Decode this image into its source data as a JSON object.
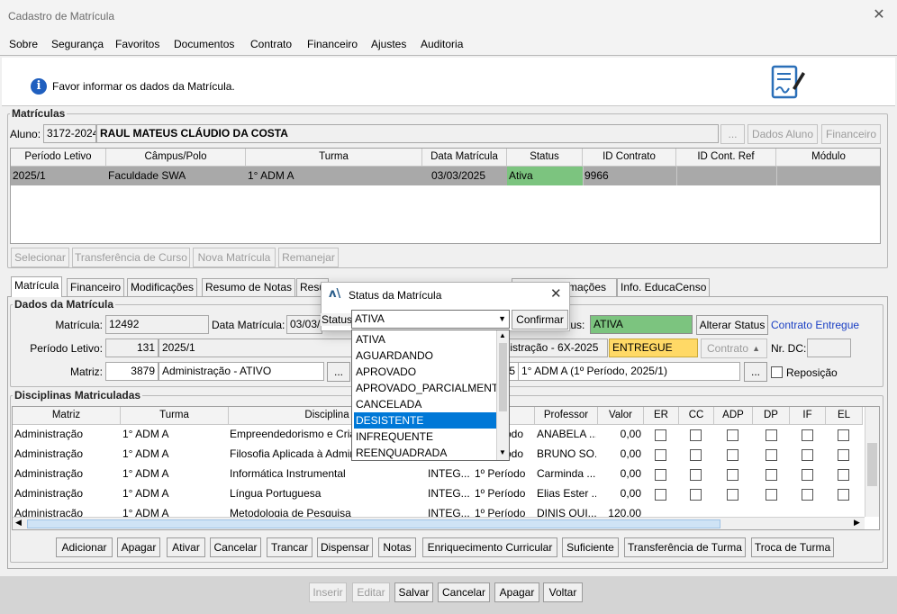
{
  "window": {
    "title": "Cadastro de Matrícula",
    "close_glyph": "✕"
  },
  "menu": [
    "Sobre",
    "Segurança",
    "Favoritos",
    "Documentos",
    "Contrato",
    "Financeiro",
    "Ajustes",
    "Auditoria"
  ],
  "header": {
    "message": "Favor informar os dados da Matrícula.",
    "info_glyph": "i"
  },
  "matriculas": {
    "legend": "Matrículas",
    "aluno_label": "Aluno:",
    "aluno_code": "3172-2024",
    "aluno_name": "RAUL MATEUS CLÁUDIO DA COSTA",
    "ellipsis": "...",
    "dados_aluno": "Dados Aluno",
    "financeiro": "Financeiro",
    "columns": [
      "Período Letivo",
      "Câmpus/Polo",
      "Turma",
      "Data Matrícula",
      "Status",
      "ID Contrato",
      "ID Cont. Ref",
      "Módulo"
    ],
    "row": [
      "2025/1",
      "Faculdade SWA",
      "1° ADM A",
      "03/03/2025",
      "Ativa",
      "9966",
      "",
      ""
    ],
    "buttons": [
      "Selecionar",
      "Transferência de Curso",
      "Nova Matrícula",
      "Remanejar"
    ]
  },
  "tabs": [
    "Matrícula",
    "Financeiro",
    "Modificações",
    "Resumo de Notas",
    "Resu",
    "rmações",
    "Info. EducaCenso"
  ],
  "dados": {
    "legend": "Dados da Matrícula",
    "matricula_label": "Matrícula:",
    "matricula_value": "12492",
    "data_label": "Data Matrícula:",
    "data_value": "03/03/",
    "status_label": "tus:",
    "status_value": "ATIVA",
    "alterar_status": "Alterar Status",
    "contrato_entregue": "Contrato Entregue",
    "periodo_label": "Período Letivo:",
    "periodo_id": "131",
    "periodo_value": "2025/1",
    "curso_value": "inistração - 6X-2025",
    "entregue": "ENTREGUE",
    "contrato_btn": "Contrato",
    "nr_dc_label": "Nr. DC:",
    "nr_dc_value": "",
    "matriz_label": "Matriz:",
    "matriz_id": "3879",
    "matriz_value": "Administração - ATIVO",
    "turma_id": "5",
    "turma_value": "1° ADM A (1º Período, 2025/1)",
    "reposicao": "Reposição"
  },
  "disciplinas": {
    "legend": "Disciplinas Matriculadas",
    "columns": [
      "Matriz",
      "Turma",
      "Disciplina",
      "",
      "",
      "Professor",
      "Valor",
      "ER",
      "CC",
      "ADP",
      "DP",
      "IF",
      "EL"
    ],
    "rows": [
      [
        "Administração",
        "1° ADM A",
        "Empreendedorismo e Cria",
        "",
        "odo",
        "ANABELA ...",
        "0,00"
      ],
      [
        "Administração",
        "1° ADM A",
        "Filosofia Aplicada à Admin",
        "",
        "odo",
        "BRUNO SO...",
        "0,00"
      ],
      [
        "Administração",
        "1° ADM A",
        "Informática Instrumental",
        "INTEG...",
        "1º Período",
        "Carminda ...",
        "0,00"
      ],
      [
        "Administração",
        "1° ADM A",
        "Língua Portuguesa",
        "INTEG...",
        "1º Período",
        "Elias Ester ...",
        "0,00"
      ],
      [
        "Administração",
        "1° ADM A",
        "Metodologia de Pesquisa",
        "INTEG...",
        "1º Período",
        "DINIS QUI...",
        "120,00"
      ]
    ],
    "buttons": [
      "Adicionar",
      "Apagar",
      "Ativar",
      "Cancelar",
      "Trancar",
      "Dispensar",
      "Notas",
      "Enriquecimento Curricular",
      "Suficiente",
      "Transferência de Turma",
      "Troca de Turma"
    ]
  },
  "dialog": {
    "title": "Status da Matrícula",
    "status_label": "Status:",
    "status_value": "ATIVA",
    "confirmar": "Confirmar",
    "options": [
      "ATIVA",
      "AGUARDANDO",
      "APROVADO",
      "APROVADO_PARCIALMENTE",
      "CANCELADA",
      "DESISTENTE",
      "INFREQUENTE",
      "REENQUADRADA"
    ],
    "selected": "DESISTENTE"
  },
  "footer": {
    "buttons": [
      "Inserir",
      "Editar",
      "Salvar",
      "Cancelar",
      "Apagar",
      "Voltar"
    ]
  },
  "colors": {
    "status_green": "#7cc47f",
    "entregue_yellow": "#ffd966",
    "selection_gray": "#a9a9a9",
    "dropdown_highlight": "#0078d7",
    "link_blue": "#1a3fc4"
  },
  "icons": [
    "info-icon",
    "document-sign-icon",
    "close-icon",
    "dropdown-arrow-icon",
    "sort-arrow-icon",
    "dialog-app-icon"
  ]
}
